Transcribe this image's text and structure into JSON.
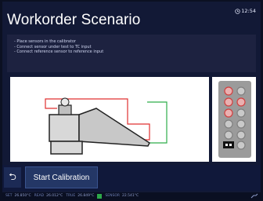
{
  "header": {
    "title": "Workorder Scenario",
    "time": "12:54"
  },
  "instructions": [
    "- Place sensors in the calibrator",
    "- Connect sensor under test to TC input",
    "- Connect reference sensor to reference input"
  ],
  "actions": {
    "start_label": "Start Calibration"
  },
  "statusbar": [
    {
      "label": "SET",
      "value": "26.850°C"
    },
    {
      "label": "READ",
      "value": "26.012°C"
    },
    {
      "label": "TRUE",
      "value": "26.849°C"
    },
    {
      "label": "SENSOR",
      "value": "22.541°C"
    }
  ],
  "colors": {
    "background": "#121936",
    "wire_red": "#e03030",
    "wire_green": "#2eae4a",
    "accent": "#243766"
  }
}
